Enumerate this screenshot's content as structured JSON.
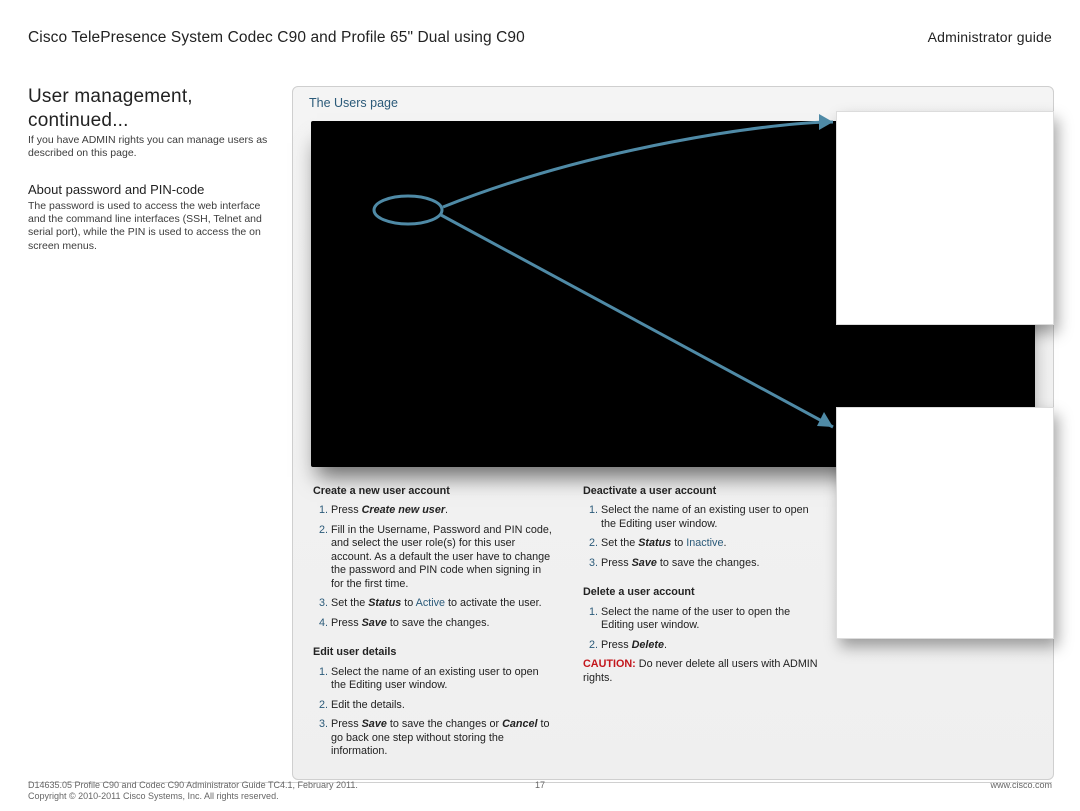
{
  "header": {
    "product": "Cisco TelePresence System Codec C90 and Profile 65\" Dual using C90",
    "guide": "Administrator guide"
  },
  "left": {
    "title1": "User management,",
    "title2": "continued...",
    "intro": "If you have ADMIN rights you can manage users as described on this page.",
    "aboutHeading": "About password and PIN-code",
    "aboutBody": "The password is used to access the web interface and the command line interfaces (SSH, Telnet and serial port), while the PIN is used to access the on screen menus."
  },
  "panel": {
    "title": "The Users page"
  },
  "instructions": {
    "createHeading": "Create a new user account",
    "createStep1_prefix": "Press ",
    "createStep1_emph": "Create new user",
    "createStep1_suffix": ".",
    "createStep2": "Fill in the Username, Password and PIN code, and select the user role(s) for this user account. As a default the user have to change the password and PIN code when signing in for the first time.",
    "createStep3_prefix": "Set the ",
    "createStep3_status": "Status",
    "createStep3_to": " to ",
    "createStep3_active": "Active",
    "createStep3_suffix": " to activate the user.",
    "saveStep_prefix": "Press ",
    "saveStep_save": "Save",
    "saveStep_suffix": " to save the changes.",
    "editHeading": "Edit user details",
    "editStep1": "Select the name of an existing user to open the Editing user window.",
    "editStep2": "Edit the details.",
    "editStep3_prefix": "Press ",
    "editStep3_save": "Save",
    "editStep3_mid": " to save the changes or ",
    "editStep3_cancel": "Cancel",
    "editStep3_suffix": " to go back one step without storing the information.",
    "deactHeading": "Deactivate a user account",
    "deactStep1": "Select the name of an existing user to open the Editing user window.",
    "deactStep2_prefix": "Set the ",
    "deactStep2_status": "Status",
    "deactStep2_to": " to ",
    "deactStep2_inactive": "Inactive",
    "deactStep2_suffix": ".",
    "deleteHeading": "Delete a user account",
    "deleteStep1": "Select the name of the user to open the Editing user window.",
    "deleteStep2_prefix": "Press ",
    "deleteStep2_delete": "Delete",
    "deleteStep2_suffix": ".",
    "cautionLabel": "CAUTION:",
    "cautionBody": " Do never delete all users with ADMIN rights."
  },
  "footer": {
    "line1": "D14635.05 Profile C90 and Codec C90 Administrator Guide TC4.1, February 2011.",
    "line2": "Copyright © 2010-2011 Cisco Systems, Inc. All rights reserved.",
    "page": "17",
    "url": "www.cisco.com"
  }
}
